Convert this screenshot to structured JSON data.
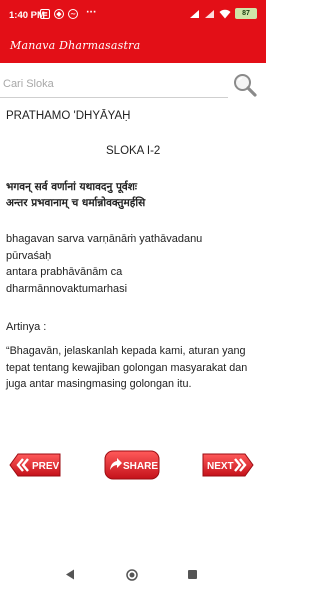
{
  "status_bar": {
    "time": "1:40 PM",
    "notification_icons": [
      "message-icon",
      "shield-icon",
      "messenger-icon"
    ],
    "more_indicator": "···",
    "battery_percent": "87"
  },
  "app_bar": {
    "title": "Manava Dharmasastra"
  },
  "search": {
    "placeholder": "Cari Sloka",
    "value": ""
  },
  "content": {
    "chapter": "PRATHAMO 'DHYĀYAḤ",
    "sloka_number": "SLOKA I-2",
    "devanagari": "भगवन् सर्व वर्णानां यथावदनु पूर्वशः\nअन्तर प्रभवानाम् च धर्मान्नोवक्तुमर्हसि",
    "transliteration": "bhagavan sarva varṇānāṁ yathāvadanu\npūrvaśaḥ\nantara prabhāvānām ca\ndharmānnovaktumarhasi",
    "artinya_label": "Artinya :",
    "translation": "“Bhagavān, jelaskanlah kepada kami, aturan yang tepat tentang kewajiban golongan masyarakat dan juga antar masingmasing golongan itu."
  },
  "buttons": {
    "prev": "PREV",
    "share": "SHARE",
    "next": "NEXT"
  },
  "colors": {
    "primary": "#e30f17",
    "button_red": "#d8141c"
  }
}
